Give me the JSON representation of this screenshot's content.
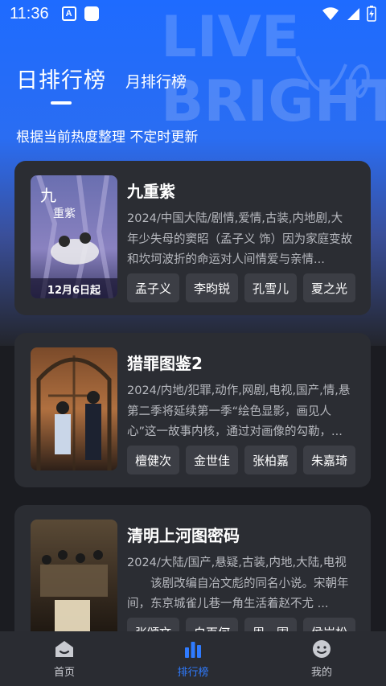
{
  "status_bar": {
    "time": "11:36",
    "badge": "A"
  },
  "tabs": {
    "day": "日排行榜",
    "month": "月排行榜"
  },
  "subtitle": "根据当前热度整理 不定时更新",
  "cards": [
    {
      "title": "九重紫",
      "meta": "2024/中国大陆/剧情,爱情,古装,内地剧,大",
      "desc": "年少失母的窦昭（孟子义 饰）因为家庭变故和坎坷波折的命运对人间情爱与亲情...",
      "tags": [
        "孟子义",
        "李昀锐",
        "孔雪儿",
        "夏之光"
      ],
      "poster_text": "12月6日起"
    },
    {
      "title": "猎罪图鉴2",
      "meta": "2024/内地/犯罪,动作,网剧,电视,国产,情,悬",
      "desc": "第二季将延续第一季“绘色显影，画见人心”这一故事内核，通过对画像的勾勒，...",
      "tags": [
        "檀健次",
        "金世佳",
        "张柏嘉",
        "朱嘉琦"
      ]
    },
    {
      "title": "清明上河图密码",
      "meta": "2024/大陆/国产,悬疑,古装,内地,大陆,电视",
      "desc": "　　该剧改编自冶文彪的同名小说。宋朝年间，东京城雀儿巷一角生活着赵不尤 ...",
      "tags": [
        "张颂文",
        "白百何",
        "周一围",
        "侯岩松"
      ]
    }
  ],
  "bottom_nav": [
    {
      "label": "首页",
      "icon": "home-icon",
      "active": false
    },
    {
      "label": "排行榜",
      "icon": "ranking-icon",
      "active": true
    },
    {
      "label": "我的",
      "icon": "profile-icon",
      "active": false
    }
  ],
  "colors": {
    "accent": "#2f7bff",
    "hero_top": "#1e6bff",
    "background": "#1b1c21",
    "card": "#2b2d33",
    "tag": "#3c3e45"
  }
}
